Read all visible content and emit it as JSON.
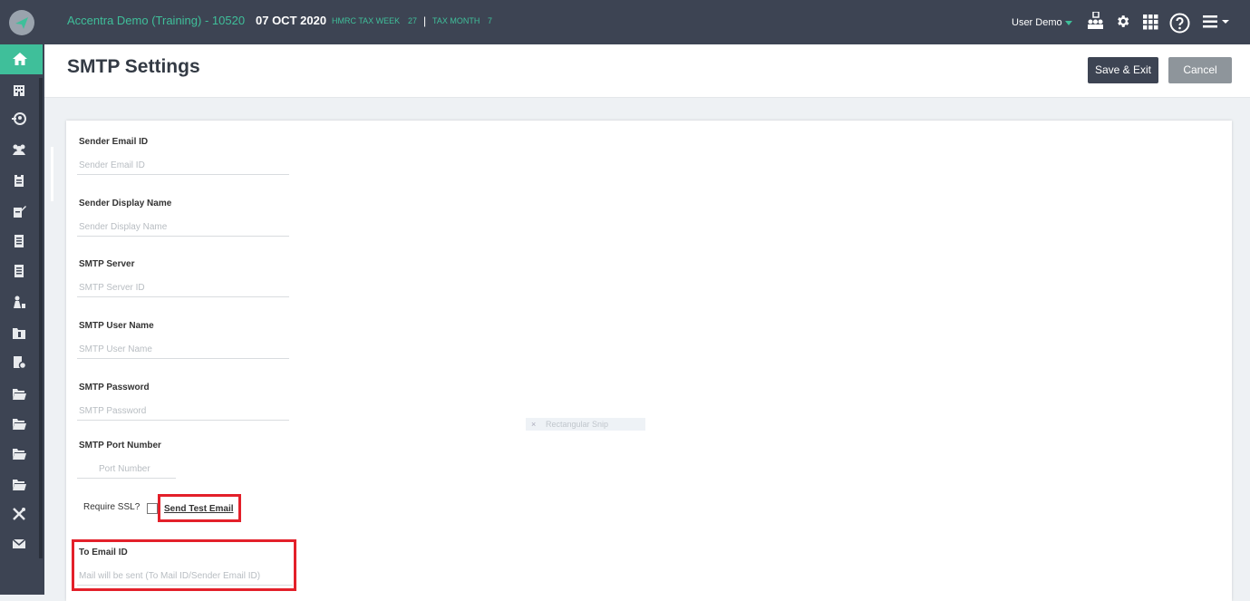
{
  "topbar": {
    "company": "Accentra Demo (Training)  - 10520",
    "date": "07 OCT 2020",
    "hmrc_label": "HMRC TAX WEEK",
    "hmrc_week": "27",
    "separator": "|",
    "tax_month_label": "TAX MONTH",
    "tax_month": "7",
    "user": "User Demo",
    "icons": [
      "org-chart-icon",
      "gear-icon",
      "apps-grid-icon",
      "help-icon",
      "menu-icon"
    ]
  },
  "sidebar": {
    "items": [
      "home-icon",
      "building-icon",
      "people-history-icon",
      "group-icon",
      "clipboard-icon",
      "edit-doc-icon",
      "document-icon",
      "document-icon-2",
      "worker-icon",
      "folder-icon",
      "doc-settings-icon",
      "folder-open-icon",
      "folder-open-icon-2",
      "folder-open-icon-3",
      "folder-open-icon-4",
      "tools-icon",
      "mail-icon"
    ]
  },
  "page": {
    "title": "SMTP Settings",
    "save_label": "Save & Exit",
    "cancel_label": "Cancel"
  },
  "form": {
    "sender_email_label": "Sender Email ID",
    "sender_email_placeholder": "Sender Email ID",
    "sender_display_label": "Sender Display Name",
    "sender_display_placeholder": "Sender Display Name",
    "smtp_server_label": "SMTP Server",
    "smtp_server_placeholder": "SMTP Server ID",
    "smtp_user_label": "SMTP User Name",
    "smtp_user_placeholder": "SMTP User Name",
    "smtp_password_label": "SMTP Password",
    "smtp_password_placeholder": "SMTP Password",
    "smtp_port_label": "SMTP Port Number",
    "smtp_port_placeholder": "Port Number",
    "ssl_label": "Require SSL?",
    "send_test_label": "Send Test Email",
    "to_email_label": "To Email ID",
    "to_email_placeholder": "Mail will be sent (To Mail ID/Sender Email ID)"
  },
  "snip": {
    "close": "×",
    "label": "Rectangular Snip"
  },
  "colors": {
    "topbar": "#3d4453",
    "accent": "#3fbf9a",
    "highlight": "#e3202a"
  }
}
